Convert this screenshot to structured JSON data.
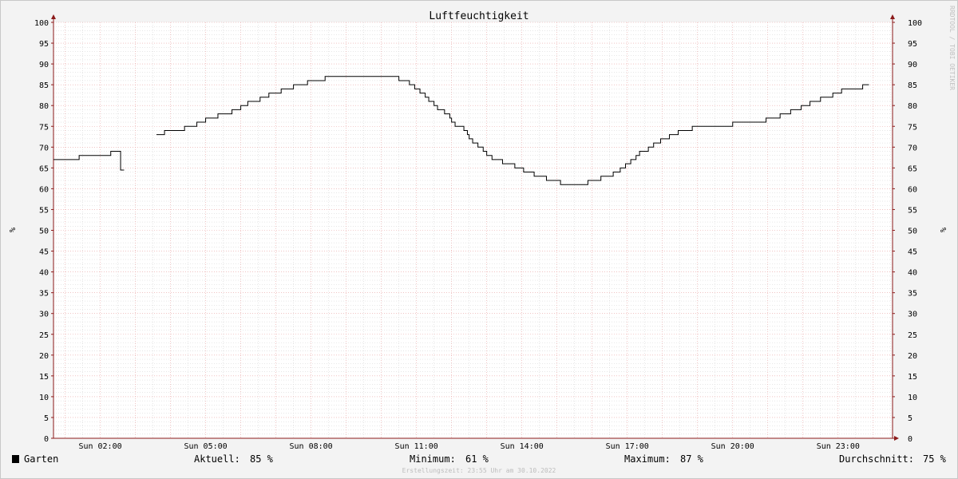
{
  "chart_data": {
    "type": "line",
    "title": "Luftfeuchtigkeit",
    "ylabel": "%",
    "ylim": [
      0,
      100
    ],
    "y_ticks": [
      0,
      5,
      10,
      15,
      20,
      25,
      30,
      35,
      40,
      45,
      50,
      55,
      60,
      65,
      70,
      75,
      80,
      85,
      90,
      95,
      100
    ],
    "xlim": [
      0.67,
      24.55
    ],
    "x_ticks": [
      {
        "x": 2,
        "label": "Sun 02:00"
      },
      {
        "x": 5,
        "label": "Sun 05:00"
      },
      {
        "x": 8,
        "label": "Sun 08:00"
      },
      {
        "x": 11,
        "label": "Sun 11:00"
      },
      {
        "x": 14,
        "label": "Sun 14:00"
      },
      {
        "x": 17,
        "label": "Sun 17:00"
      },
      {
        "x": 20,
        "label": "Sun 20:00"
      },
      {
        "x": 23,
        "label": "Sun 23:00"
      }
    ],
    "grid": true,
    "vertical_side_text": "RRDTOOL / TOBI OETIKER",
    "series": [
      {
        "name": "Garten",
        "color": "#000000",
        "segments": [
          [
            [
              0.67,
              67
            ],
            [
              1.4,
              67
            ],
            [
              1.4,
              68
            ],
            [
              2.3,
              68
            ],
            [
              2.3,
              69
            ],
            [
              2.58,
              69
            ],
            [
              2.58,
              64.5
            ],
            [
              2.68,
              64.5
            ]
          ],
          [
            [
              3.6,
              73
            ],
            [
              3.83,
              73
            ],
            [
              3.83,
              74
            ],
            [
              4.4,
              74
            ],
            [
              4.4,
              75
            ],
            [
              4.75,
              75
            ],
            [
              4.75,
              76
            ],
            [
              5.0,
              76
            ],
            [
              5.0,
              77
            ],
            [
              5.35,
              77
            ],
            [
              5.35,
              78
            ],
            [
              5.75,
              78
            ],
            [
              5.75,
              79
            ],
            [
              6.0,
              79
            ],
            [
              6.0,
              80
            ],
            [
              6.2,
              80
            ],
            [
              6.2,
              81
            ],
            [
              6.55,
              81
            ],
            [
              6.55,
              82
            ],
            [
              6.8,
              82
            ],
            [
              6.8,
              83
            ],
            [
              7.15,
              83
            ],
            [
              7.15,
              84
            ],
            [
              7.5,
              84
            ],
            [
              7.5,
              85
            ],
            [
              7.9,
              85
            ],
            [
              7.9,
              86
            ],
            [
              8.4,
              86
            ],
            [
              8.4,
              87
            ],
            [
              10.5,
              87
            ],
            [
              10.5,
              86
            ],
            [
              10.8,
              86
            ],
            [
              10.8,
              85
            ],
            [
              10.95,
              85
            ],
            [
              10.95,
              84
            ],
            [
              11.1,
              84
            ],
            [
              11.1,
              83
            ],
            [
              11.25,
              83
            ],
            [
              11.25,
              82
            ],
            [
              11.35,
              82
            ],
            [
              11.35,
              81
            ],
            [
              11.5,
              81
            ],
            [
              11.5,
              80
            ],
            [
              11.6,
              80
            ],
            [
              11.6,
              79
            ],
            [
              11.8,
              79
            ],
            [
              11.8,
              78
            ],
            [
              11.95,
              78
            ],
            [
              11.95,
              77
            ],
            [
              12.0,
              77
            ],
            [
              12.0,
              76
            ],
            [
              12.1,
              76
            ],
            [
              12.1,
              75
            ],
            [
              12.35,
              75
            ],
            [
              12.35,
              74
            ],
            [
              12.45,
              74
            ],
            [
              12.45,
              73
            ],
            [
              12.5,
              73
            ],
            [
              12.5,
              72
            ],
            [
              12.6,
              72
            ],
            [
              12.6,
              71
            ],
            [
              12.75,
              71
            ],
            [
              12.75,
              70
            ],
            [
              12.9,
              70
            ],
            [
              12.9,
              69
            ],
            [
              13.0,
              69
            ],
            [
              13.0,
              68
            ],
            [
              13.15,
              68
            ],
            [
              13.15,
              67
            ],
            [
              13.45,
              67
            ],
            [
              13.45,
              66
            ],
            [
              13.8,
              66
            ],
            [
              13.8,
              65
            ],
            [
              14.05,
              65
            ],
            [
              14.05,
              64
            ],
            [
              14.35,
              64
            ],
            [
              14.35,
              63
            ],
            [
              14.7,
              63
            ],
            [
              14.7,
              62
            ],
            [
              15.1,
              62
            ],
            [
              15.1,
              61
            ],
            [
              15.88,
              61
            ],
            [
              15.88,
              62
            ],
            [
              16.25,
              62
            ],
            [
              16.25,
              63
            ],
            [
              16.6,
              63
            ],
            [
              16.6,
              64
            ],
            [
              16.8,
              64
            ],
            [
              16.8,
              65
            ],
            [
              16.95,
              65
            ],
            [
              16.95,
              66
            ],
            [
              17.1,
              66
            ],
            [
              17.1,
              67
            ],
            [
              17.25,
              67
            ],
            [
              17.25,
              68
            ],
            [
              17.35,
              68
            ],
            [
              17.35,
              69
            ],
            [
              17.6,
              69
            ],
            [
              17.6,
              70
            ],
            [
              17.75,
              70
            ],
            [
              17.75,
              71
            ],
            [
              17.95,
              71
            ],
            [
              17.95,
              72
            ],
            [
              18.2,
              72
            ],
            [
              18.2,
              73
            ],
            [
              18.45,
              73
            ],
            [
              18.45,
              74
            ],
            [
              18.85,
              74
            ],
            [
              18.85,
              75
            ],
            [
              20.0,
              75
            ],
            [
              20.0,
              76
            ],
            [
              20.95,
              76
            ],
            [
              20.95,
              77
            ],
            [
              21.35,
              77
            ],
            [
              21.35,
              78
            ],
            [
              21.65,
              78
            ],
            [
              21.65,
              79
            ],
            [
              21.95,
              79
            ],
            [
              21.95,
              80
            ],
            [
              22.2,
              80
            ],
            [
              22.2,
              81
            ],
            [
              22.5,
              81
            ],
            [
              22.5,
              82
            ],
            [
              22.85,
              82
            ],
            [
              22.85,
              83
            ],
            [
              23.1,
              83
            ],
            [
              23.1,
              84
            ],
            [
              23.7,
              84
            ],
            [
              23.7,
              85
            ],
            [
              23.88,
              85
            ]
          ]
        ]
      }
    ]
  },
  "legend": {
    "series_name": "Garten",
    "current_label": "Aktuell:",
    "current_value": "85 %",
    "min_label": "Minimum:",
    "min_value": "61 %",
    "max_label": "Maximum:",
    "max_value": "87 %",
    "avg_label": "Durchschnitt:",
    "avg_value": "75 %"
  },
  "footer": {
    "created": "Erstellungszeit: 23:55 Uhr am 30.10.2022"
  },
  "colors": {
    "background": "#f3f3f3",
    "plot_background": "#ffffff",
    "grid_major": "#e8a0a0",
    "grid_minor": "#cfcfcf",
    "axis": "#8b1a1a",
    "line": "#000000"
  }
}
